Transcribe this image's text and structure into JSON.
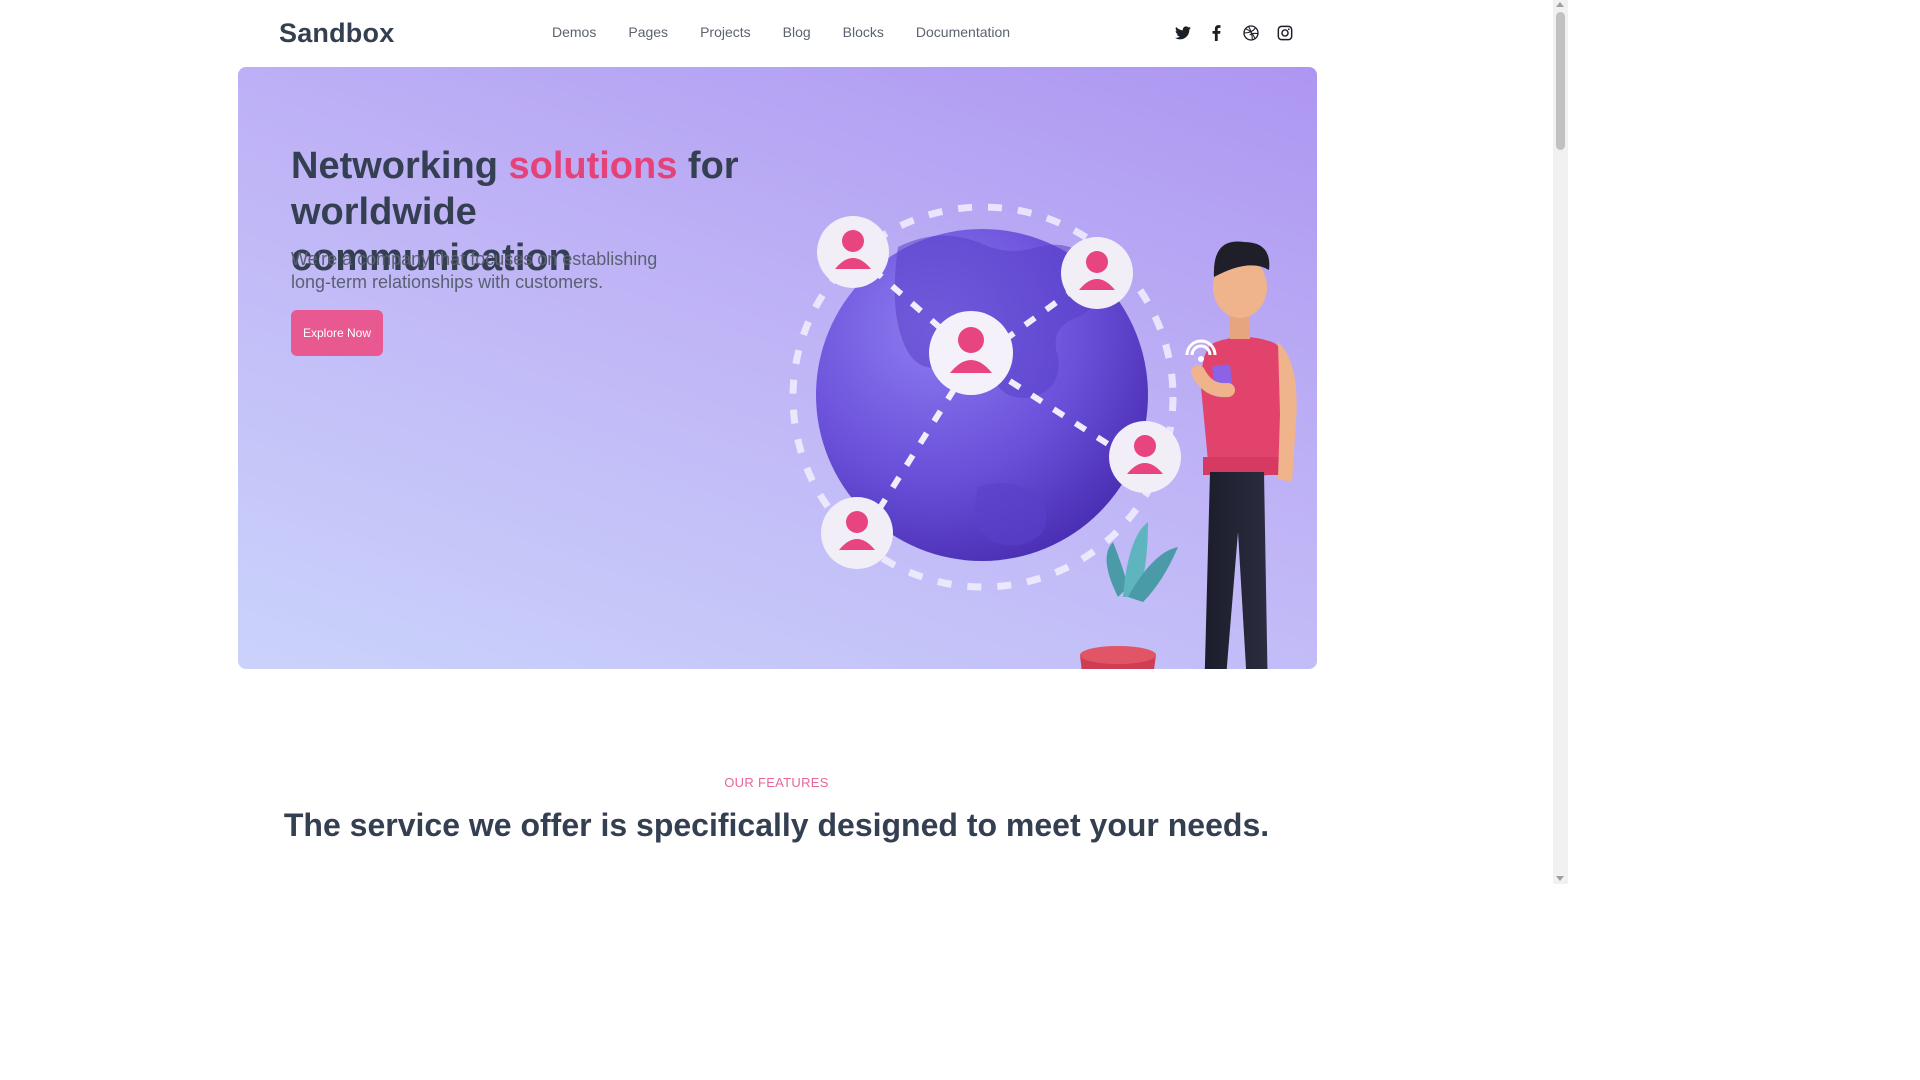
{
  "header": {
    "logo_text": "Sandbox",
    "nav": [
      "Demos",
      "Pages",
      "Projects",
      "Blog",
      "Blocks",
      "Documentation"
    ],
    "social_icons": [
      "twitter-icon",
      "facebook-icon",
      "dribbble-icon",
      "instagram-icon"
    ]
  },
  "hero": {
    "title_part1": "Networking ",
    "title_accent": "solutions",
    "title_part2": " for worldwide communication",
    "subtitle": "We're a company that focuses on establishing long-term relationships with customers.",
    "button_label": "Explore Now"
  },
  "features": {
    "label": "OUR FEATURES",
    "title": "The service we offer is specifically designed to meet your needs."
  },
  "colors": {
    "accent": "#e6427a",
    "button": "#e85891",
    "text_dark": "#343f52",
    "hero_gradient_top": "#ad96f1",
    "hero_gradient_bottom": "#cad3fb"
  }
}
